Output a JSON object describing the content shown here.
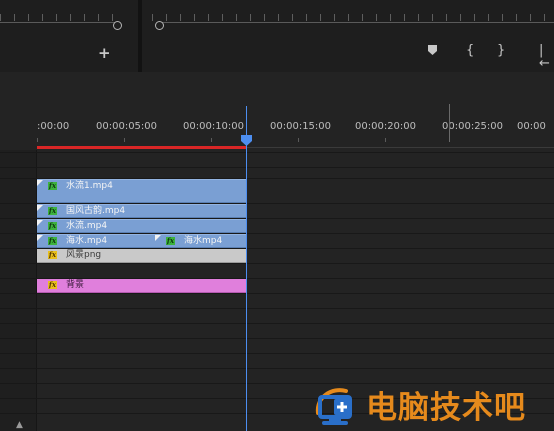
{
  "source_monitor": {
    "add_button_icon": "plus-icon",
    "add_button_label": "+"
  },
  "program_monitor": {
    "marker_icon": "marker-icon",
    "mark_in_icon": "mark-in-icon",
    "mark_in_label": "{",
    "mark_out_icon": "mark-out-icon",
    "mark_out_label": "}",
    "go_to_in_icon": "go-to-in-icon",
    "go_to_in_label": "|←"
  },
  "timeline": {
    "ruler_labels": [
      ":00:00",
      "00:00:05:00",
      "00:00:10:00",
      "00:00:15:00",
      "00:00:20:00",
      "00:00:25:00",
      "00:00"
    ],
    "playhead_time": "00:00:10:00",
    "colors": {
      "work_area": "#d92626",
      "playhead": "#4d8ef0",
      "video_clip": "#7a9fd3",
      "still_clip": "#c9c9c9",
      "bg_clip": "#e07fdc"
    },
    "clips": [
      {
        "name": "水流1.mp4",
        "kind": "video",
        "fx_icon": "fx-badge-icon"
      },
      {
        "name": "国风古韵.mp4",
        "kind": "video",
        "fx_icon": "fx-badge-icon"
      },
      {
        "name": "水流.mp4",
        "kind": "video",
        "fx_icon": "fx-badge-icon"
      },
      {
        "name": "海水.mp4",
        "kind": "video",
        "fx_icon": "fx-badge-icon"
      },
      {
        "name": "海水mp4",
        "kind": "video",
        "fx_icon": "fx-badge-icon"
      },
      {
        "name": "风景png",
        "kind": "still",
        "fx_icon": "fx-badge-icon"
      },
      {
        "name": "背景",
        "kind": "bg",
        "fx_icon": "fx-badge-icon"
      }
    ],
    "fx_label": "fx"
  },
  "watermark": {
    "text": "电脑技术吧",
    "logo_icon": "monitor-logo-icon",
    "color": "#e68a1c"
  }
}
